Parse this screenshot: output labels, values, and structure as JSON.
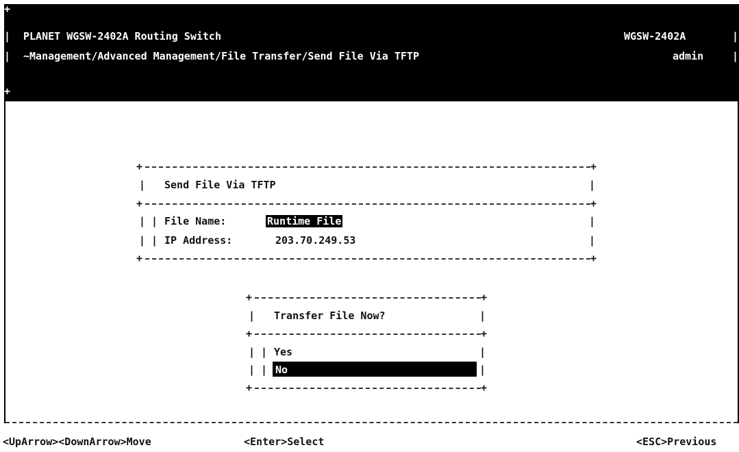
{
  "header": {
    "title": "PLANET WGSW-2402A Routing Switch",
    "model": "WGSW-2402A",
    "breadcrumb": "~Management/Advanced Management/File Transfer/Send File Via TFTP",
    "user": "admin"
  },
  "dialog": {
    "title": "Send File Via TFTP",
    "file_name_label": "File Name:",
    "file_name_value": "Runtime File",
    "ip_label": "IP Address:",
    "ip_value": "203.70.249.53"
  },
  "confirm": {
    "title": "Transfer File Now?",
    "options": [
      "Yes",
      "No"
    ],
    "selected": "No"
  },
  "footer": {
    "move": "<UpArrow><DownArrow>Move",
    "select": "<Enter>Select",
    "previous": "<ESC>Previous"
  }
}
